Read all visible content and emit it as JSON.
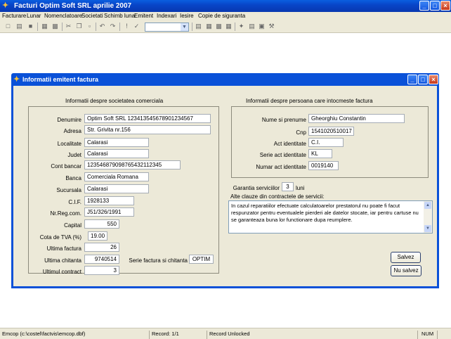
{
  "window": {
    "title": "Facturi Optim Soft SRL aprilie 2007"
  },
  "menu": [
    "Facturare",
    "Lunar",
    "Nomenclatoare",
    "Societati",
    "Schimb luna",
    "Emitent",
    "Indexari",
    "Iesire",
    "Copie de siguranta"
  ],
  "dialog": {
    "title": "Informatii emitent factura",
    "company_group": {
      "heading": "Informatii despre societatea comerciala",
      "denumire": {
        "label": "Denumire",
        "value": "Optim Soft SRL 1234135456789012345​67"
      },
      "adresa": {
        "label": "Adresa",
        "value": "Str. Grivita nr.156"
      },
      "localitate": {
        "label": "Localitate",
        "value": "Calarasi"
      },
      "judet": {
        "label": "Judet",
        "value": "Calarasi"
      },
      "cont_bancar": {
        "label": "Cont bancar",
        "value": "12354687909876543211​2345"
      },
      "banca": {
        "label": "Banca",
        "value": "Comerciala Romana"
      },
      "sucursala": {
        "label": "Sucursala",
        "value": "Calarasi"
      },
      "cif": {
        "label": "C.I.F.",
        "value": "1928133"
      },
      "nr_reg_com": {
        "label": "Nr.Reg.com.",
        "value": "J51/326/1991"
      },
      "capital": {
        "label": "Capital",
        "value": "550"
      },
      "cota_tva": {
        "label": "Cota de TVA (%)",
        "value": "19.00"
      },
      "ultima_factura": {
        "label": "Ultima factura",
        "value": "26"
      },
      "ultima_chitanta": {
        "label": "Ultima chitanta",
        "value": "9740514"
      },
      "ultimul_contract": {
        "label": "Ultimul contract",
        "value": "3"
      },
      "serie_factura": {
        "label": "Serie factura si chitanta",
        "value": "OPTIM"
      }
    },
    "person_group": {
      "heading": "Informatii despre persoana care intocmeste factura",
      "nume": {
        "label": "Nume si prenume",
        "value": "Gheorghiu Constantin"
      },
      "cnp": {
        "label": "Cnp",
        "value": "1541020510017"
      },
      "act": {
        "label": "Act identitate",
        "value": "C.I."
      },
      "serie_act": {
        "label": "Serie act identitate",
        "value": "KL"
      },
      "numar_act": {
        "label": "Numar act identitate",
        "value": "0019140"
      }
    },
    "garantie": {
      "label": "Garantia serviciilor",
      "value": "3",
      "unit": "luni"
    },
    "clauze": {
      "label": "Alte clauze din contractele de servicii:",
      "text": "In cazul reparatiilor efectuate calculatoarelor prestatorul nu poate fi facut respunzator pentru eventualele pierderi ale datelor stocate, iar pentru cartuse nu se garanteaza buna lor functionare dupa reumplere."
    },
    "buttons": {
      "save": "Salvez",
      "cancel": "Nu salvez"
    }
  },
  "status": {
    "file": "Emcop (c:\\costel\\factvis\\emcop.dbf)",
    "record": "Record: 1/1",
    "lock": "Record Unlocked",
    "num": "NUM"
  }
}
